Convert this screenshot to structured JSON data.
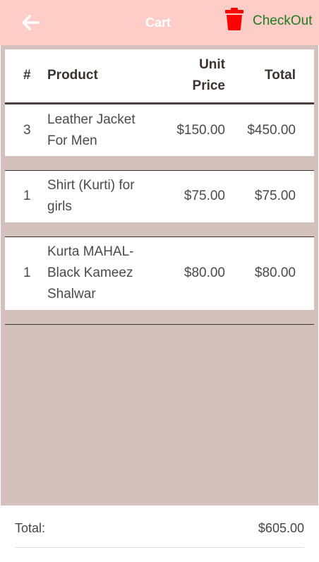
{
  "header": {
    "title": "Cart",
    "checkout_label": "CheckOut",
    "back_icon": "arrow-left-icon",
    "delete_icon": "trash-icon",
    "background_color": "#ffcdc8",
    "checkout_color": "#1e7b1e",
    "trash_color": "#ff0000"
  },
  "table": {
    "columns": {
      "num": "#",
      "product": "Product",
      "unit_price_line1": "Unit",
      "unit_price_line2": "Price",
      "total": "Total"
    },
    "rows": [
      {
        "qty": "3",
        "product_line1": "Leather Jacket",
        "product_line2": "For Men",
        "product_line3": "",
        "unit_price": "$150.00",
        "total": "$450.00"
      },
      {
        "qty": "1",
        "product_line1": "Shirt (Kurti) for",
        "product_line2": "girls",
        "product_line3": "",
        "unit_price": "$75.00",
        "total": "$75.00"
      },
      {
        "qty": "1",
        "product_line1": "Kurta MAHAL-",
        "product_line2": "Black Kameez",
        "product_line3": "Shalwar",
        "unit_price": "$80.00",
        "total": "$80.00"
      }
    ]
  },
  "footer": {
    "total_label": "Total:",
    "total_value": "$605.00"
  }
}
